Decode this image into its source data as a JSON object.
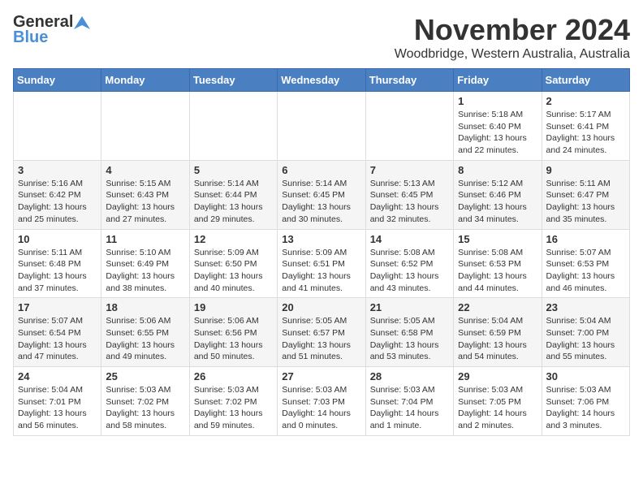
{
  "header": {
    "logo_general": "General",
    "logo_blue": "Blue",
    "month": "November 2024",
    "location": "Woodbridge, Western Australia, Australia"
  },
  "weekdays": [
    "Sunday",
    "Monday",
    "Tuesday",
    "Wednesday",
    "Thursday",
    "Friday",
    "Saturday"
  ],
  "weeks": [
    [
      {
        "day": "",
        "info": ""
      },
      {
        "day": "",
        "info": ""
      },
      {
        "day": "",
        "info": ""
      },
      {
        "day": "",
        "info": ""
      },
      {
        "day": "",
        "info": ""
      },
      {
        "day": "1",
        "info": "Sunrise: 5:18 AM\nSunset: 6:40 PM\nDaylight: 13 hours\nand 22 minutes."
      },
      {
        "day": "2",
        "info": "Sunrise: 5:17 AM\nSunset: 6:41 PM\nDaylight: 13 hours\nand 24 minutes."
      }
    ],
    [
      {
        "day": "3",
        "info": "Sunrise: 5:16 AM\nSunset: 6:42 PM\nDaylight: 13 hours\nand 25 minutes."
      },
      {
        "day": "4",
        "info": "Sunrise: 5:15 AM\nSunset: 6:43 PM\nDaylight: 13 hours\nand 27 minutes."
      },
      {
        "day": "5",
        "info": "Sunrise: 5:14 AM\nSunset: 6:44 PM\nDaylight: 13 hours\nand 29 minutes."
      },
      {
        "day": "6",
        "info": "Sunrise: 5:14 AM\nSunset: 6:45 PM\nDaylight: 13 hours\nand 30 minutes."
      },
      {
        "day": "7",
        "info": "Sunrise: 5:13 AM\nSunset: 6:45 PM\nDaylight: 13 hours\nand 32 minutes."
      },
      {
        "day": "8",
        "info": "Sunrise: 5:12 AM\nSunset: 6:46 PM\nDaylight: 13 hours\nand 34 minutes."
      },
      {
        "day": "9",
        "info": "Sunrise: 5:11 AM\nSunset: 6:47 PM\nDaylight: 13 hours\nand 35 minutes."
      }
    ],
    [
      {
        "day": "10",
        "info": "Sunrise: 5:11 AM\nSunset: 6:48 PM\nDaylight: 13 hours\nand 37 minutes."
      },
      {
        "day": "11",
        "info": "Sunrise: 5:10 AM\nSunset: 6:49 PM\nDaylight: 13 hours\nand 38 minutes."
      },
      {
        "day": "12",
        "info": "Sunrise: 5:09 AM\nSunset: 6:50 PM\nDaylight: 13 hours\nand 40 minutes."
      },
      {
        "day": "13",
        "info": "Sunrise: 5:09 AM\nSunset: 6:51 PM\nDaylight: 13 hours\nand 41 minutes."
      },
      {
        "day": "14",
        "info": "Sunrise: 5:08 AM\nSunset: 6:52 PM\nDaylight: 13 hours\nand 43 minutes."
      },
      {
        "day": "15",
        "info": "Sunrise: 5:08 AM\nSunset: 6:53 PM\nDaylight: 13 hours\nand 44 minutes."
      },
      {
        "day": "16",
        "info": "Sunrise: 5:07 AM\nSunset: 6:53 PM\nDaylight: 13 hours\nand 46 minutes."
      }
    ],
    [
      {
        "day": "17",
        "info": "Sunrise: 5:07 AM\nSunset: 6:54 PM\nDaylight: 13 hours\nand 47 minutes."
      },
      {
        "day": "18",
        "info": "Sunrise: 5:06 AM\nSunset: 6:55 PM\nDaylight: 13 hours\nand 49 minutes."
      },
      {
        "day": "19",
        "info": "Sunrise: 5:06 AM\nSunset: 6:56 PM\nDaylight: 13 hours\nand 50 minutes."
      },
      {
        "day": "20",
        "info": "Sunrise: 5:05 AM\nSunset: 6:57 PM\nDaylight: 13 hours\nand 51 minutes."
      },
      {
        "day": "21",
        "info": "Sunrise: 5:05 AM\nSunset: 6:58 PM\nDaylight: 13 hours\nand 53 minutes."
      },
      {
        "day": "22",
        "info": "Sunrise: 5:04 AM\nSunset: 6:59 PM\nDaylight: 13 hours\nand 54 minutes."
      },
      {
        "day": "23",
        "info": "Sunrise: 5:04 AM\nSunset: 7:00 PM\nDaylight: 13 hours\nand 55 minutes."
      }
    ],
    [
      {
        "day": "24",
        "info": "Sunrise: 5:04 AM\nSunset: 7:01 PM\nDaylight: 13 hours\nand 56 minutes."
      },
      {
        "day": "25",
        "info": "Sunrise: 5:03 AM\nSunset: 7:02 PM\nDaylight: 13 hours\nand 58 minutes."
      },
      {
        "day": "26",
        "info": "Sunrise: 5:03 AM\nSunset: 7:02 PM\nDaylight: 13 hours\nand 59 minutes."
      },
      {
        "day": "27",
        "info": "Sunrise: 5:03 AM\nSunset: 7:03 PM\nDaylight: 14 hours\nand 0 minutes."
      },
      {
        "day": "28",
        "info": "Sunrise: 5:03 AM\nSunset: 7:04 PM\nDaylight: 14 hours\nand 1 minute."
      },
      {
        "day": "29",
        "info": "Sunrise: 5:03 AM\nSunset: 7:05 PM\nDaylight: 14 hours\nand 2 minutes."
      },
      {
        "day": "30",
        "info": "Sunrise: 5:03 AM\nSunset: 7:06 PM\nDaylight: 14 hours\nand 3 minutes."
      }
    ]
  ]
}
